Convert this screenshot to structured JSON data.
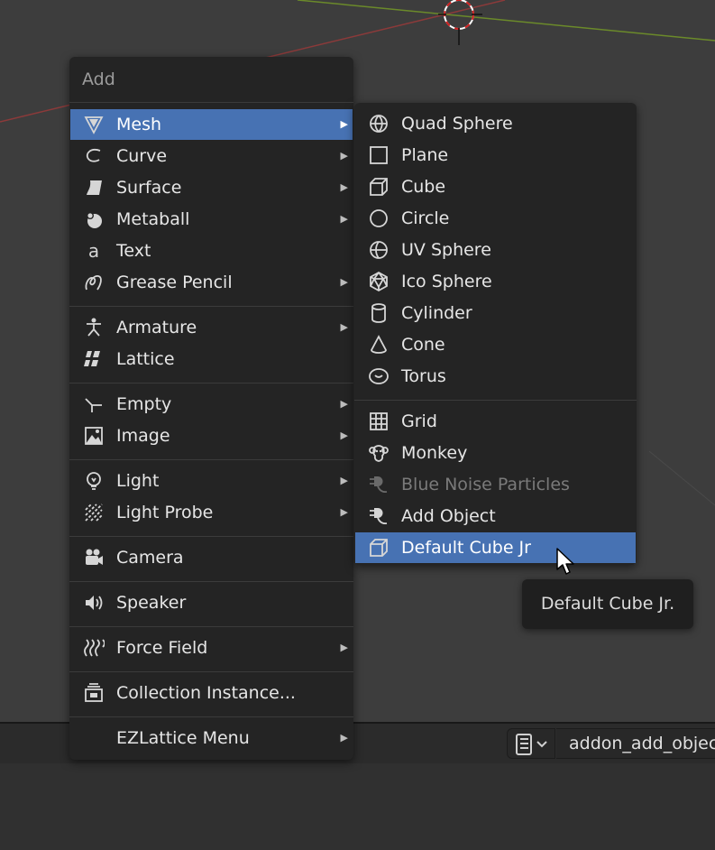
{
  "add_menu": {
    "title": "Add",
    "items": [
      {
        "label": "Mesh",
        "icon": "mesh-icon",
        "submenu": true,
        "active": true
      },
      {
        "label": "Curve",
        "icon": "curve-icon",
        "submenu": true
      },
      {
        "label": "Surface",
        "icon": "surface-icon",
        "submenu": true
      },
      {
        "label": "Metaball",
        "icon": "metaball-icon",
        "submenu": true
      },
      {
        "label": "Text",
        "icon": "text-icon",
        "submenu": false
      },
      {
        "label": "Grease Pencil",
        "icon": "grease-pencil-icon",
        "submenu": true
      },
      {
        "label": "Armature",
        "icon": "armature-icon",
        "submenu": true
      },
      {
        "label": "Lattice",
        "icon": "lattice-icon",
        "submenu": false
      },
      {
        "label": "Empty",
        "icon": "empty-icon",
        "submenu": true
      },
      {
        "label": "Image",
        "icon": "image-icon",
        "submenu": true
      },
      {
        "label": "Light",
        "icon": "light-icon",
        "submenu": true
      },
      {
        "label": "Light Probe",
        "icon": "light-probe-icon",
        "submenu": true
      },
      {
        "label": "Camera",
        "icon": "camera-icon",
        "submenu": false
      },
      {
        "label": "Speaker",
        "icon": "speaker-icon",
        "submenu": false
      },
      {
        "label": "Force Field",
        "icon": "force-field-icon",
        "submenu": true
      },
      {
        "label": "Collection Instance...",
        "icon": "collection-instance-icon",
        "submenu": false
      },
      {
        "label": "EZLattice Menu",
        "icon": "",
        "submenu": true
      }
    ]
  },
  "mesh_menu": {
    "items": [
      {
        "label": "Quad Sphere",
        "icon": "quad-sphere-icon"
      },
      {
        "label": "Plane",
        "icon": "plane-icon"
      },
      {
        "label": "Cube",
        "icon": "cube-icon"
      },
      {
        "label": "Circle",
        "icon": "circle-icon"
      },
      {
        "label": "UV Sphere",
        "icon": "uv-sphere-icon"
      },
      {
        "label": "Ico Sphere",
        "icon": "ico-sphere-icon"
      },
      {
        "label": "Cylinder",
        "icon": "cylinder-icon"
      },
      {
        "label": "Cone",
        "icon": "cone-icon"
      },
      {
        "label": "Torus",
        "icon": "torus-icon"
      },
      {
        "label": "Grid",
        "icon": "grid-icon"
      },
      {
        "label": "Monkey",
        "icon": "monkey-icon"
      },
      {
        "label": "Blue Noise Particles",
        "icon": "plugin-icon",
        "disabled": true
      },
      {
        "label": "Add Object",
        "icon": "plugin-icon"
      },
      {
        "label": "Default Cube Jr",
        "icon": "cube-icon",
        "active": true
      }
    ]
  },
  "tooltip": {
    "text": "Default Cube Jr."
  },
  "text_editor": {
    "name": "addon_add_object"
  },
  "colors": {
    "accent": "#4772b3",
    "menu_bg": "#242424",
    "viewport_bg": "#3d3d3d"
  }
}
